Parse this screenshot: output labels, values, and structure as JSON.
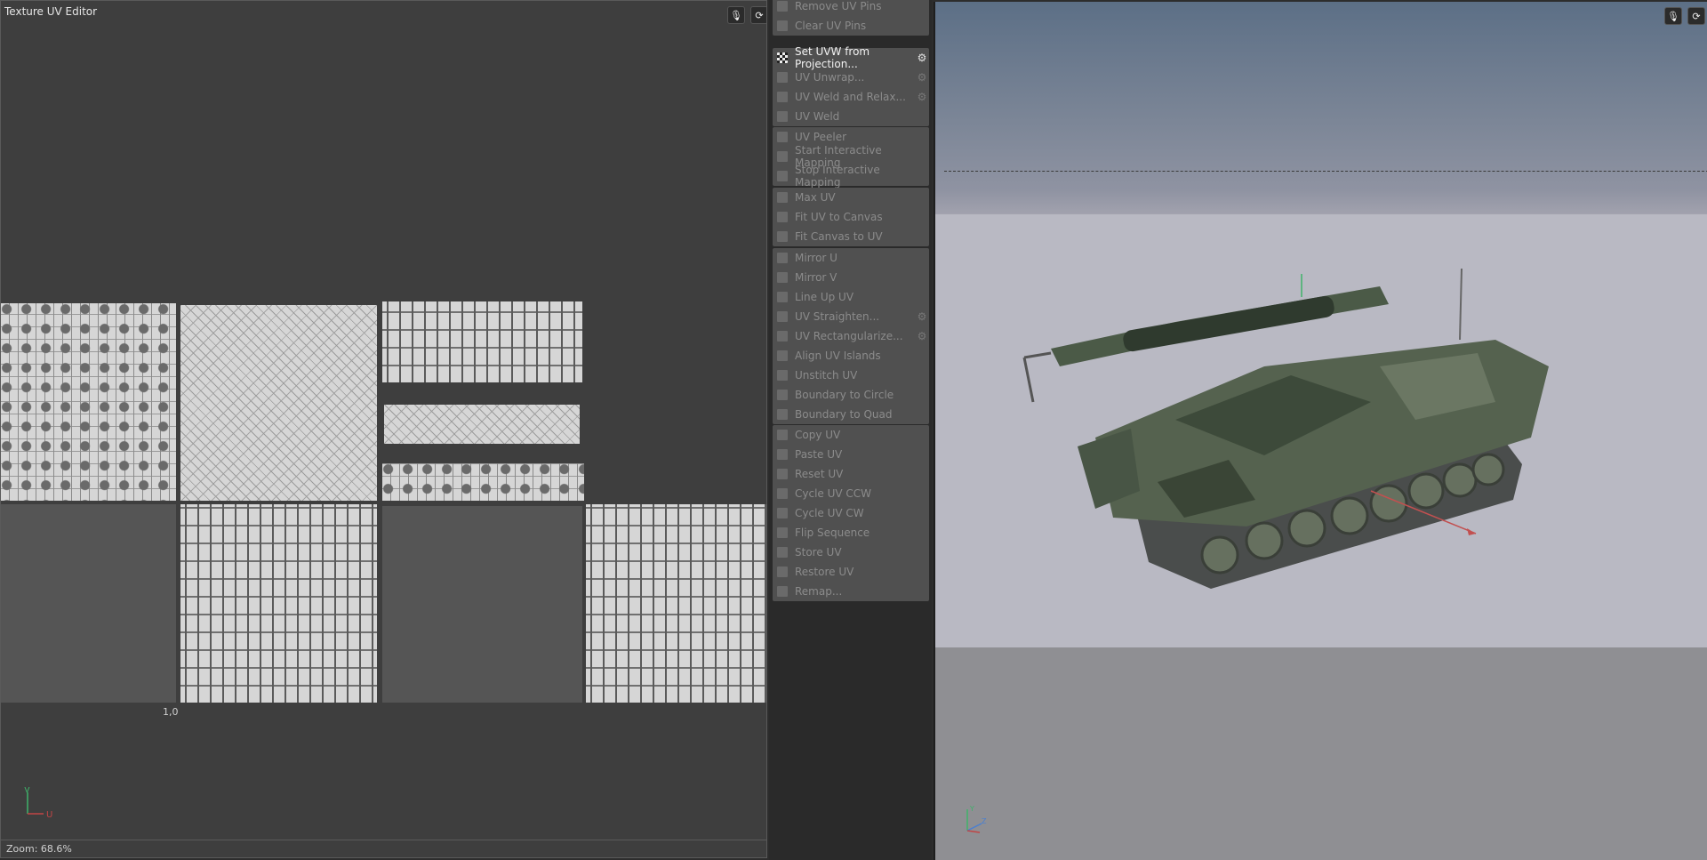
{
  "uv_editor": {
    "title": "Texture UV Editor",
    "coordinate_label": "1,0",
    "axis_v": "V",
    "axis_u": "U",
    "zoom": "Zoom: 68.6%",
    "icons": [
      "microphone-icon",
      "refresh-icon"
    ]
  },
  "commands": {
    "group1": [
      {
        "label": "Remove UV Pins",
        "icon": "remove-pins-icon"
      },
      {
        "label": "Clear UV Pins",
        "icon": "clear-pins-icon"
      }
    ],
    "group2": [
      {
        "label": "Set UVW from Projection...",
        "icon": "checker-icon",
        "active": true,
        "gear": true
      },
      {
        "label": "UV Unwrap...",
        "icon": "unwrap-icon",
        "gear": true
      },
      {
        "label": "UV Weld and Relax...",
        "icon": "weld-relax-icon",
        "gear": true
      },
      {
        "label": "UV Weld",
        "icon": "weld-icon"
      }
    ],
    "group3": [
      {
        "label": "UV Peeler",
        "icon": "peeler-icon"
      },
      {
        "label": "Start Interactive Mapping",
        "icon": "start-mapping-icon"
      },
      {
        "label": "Stop Interactive Mapping",
        "icon": "stop-mapping-icon"
      }
    ],
    "group4": [
      {
        "label": "Max UV",
        "icon": "max-uv-icon"
      },
      {
        "label": "Fit UV to Canvas",
        "icon": "fit-uv-icon"
      },
      {
        "label": "Fit Canvas to UV",
        "icon": "fit-canvas-icon"
      }
    ],
    "group5": [
      {
        "label": "Mirror U",
        "icon": "mirror-u-icon"
      },
      {
        "label": "Mirror V",
        "icon": "mirror-v-icon"
      },
      {
        "label": "Line Up UV",
        "icon": "line-up-icon"
      },
      {
        "label": "UV Straighten...",
        "icon": "straighten-icon",
        "gear": true
      },
      {
        "label": "UV Rectangularize...",
        "icon": "rectangularize-icon",
        "gear": true
      },
      {
        "label": "Align UV Islands",
        "icon": "align-islands-icon"
      },
      {
        "label": "Unstitch UV",
        "icon": "unstitch-icon"
      },
      {
        "label": "Boundary to Circle",
        "icon": "boundary-circle-icon"
      },
      {
        "label": "Boundary to Quad",
        "icon": "boundary-quad-icon"
      }
    ],
    "group6": [
      {
        "label": "Copy UV",
        "icon": "copy-icon"
      },
      {
        "label": "Paste UV",
        "icon": "paste-icon"
      },
      {
        "label": "Reset UV",
        "icon": "reset-icon"
      },
      {
        "label": "Cycle UV CCW",
        "icon": "cycle-ccw-icon"
      },
      {
        "label": "Cycle UV CW",
        "icon": "cycle-cw-icon"
      },
      {
        "label": "Flip Sequence",
        "icon": "flip-icon"
      },
      {
        "label": "Store UV",
        "icon": "store-icon"
      },
      {
        "label": "Restore UV",
        "icon": "restore-icon"
      },
      {
        "label": "Remap...",
        "icon": "remap-icon"
      }
    ]
  },
  "viewport": {
    "axis_y": "Y",
    "axis_z": "Z",
    "icons": [
      "microphone-icon",
      "refresh-icon"
    ],
    "colors": {
      "sky_top": "#5c6f86",
      "wall": "#b9b9c3",
      "floor": "#8f8f93",
      "tank": "#55624f"
    }
  }
}
